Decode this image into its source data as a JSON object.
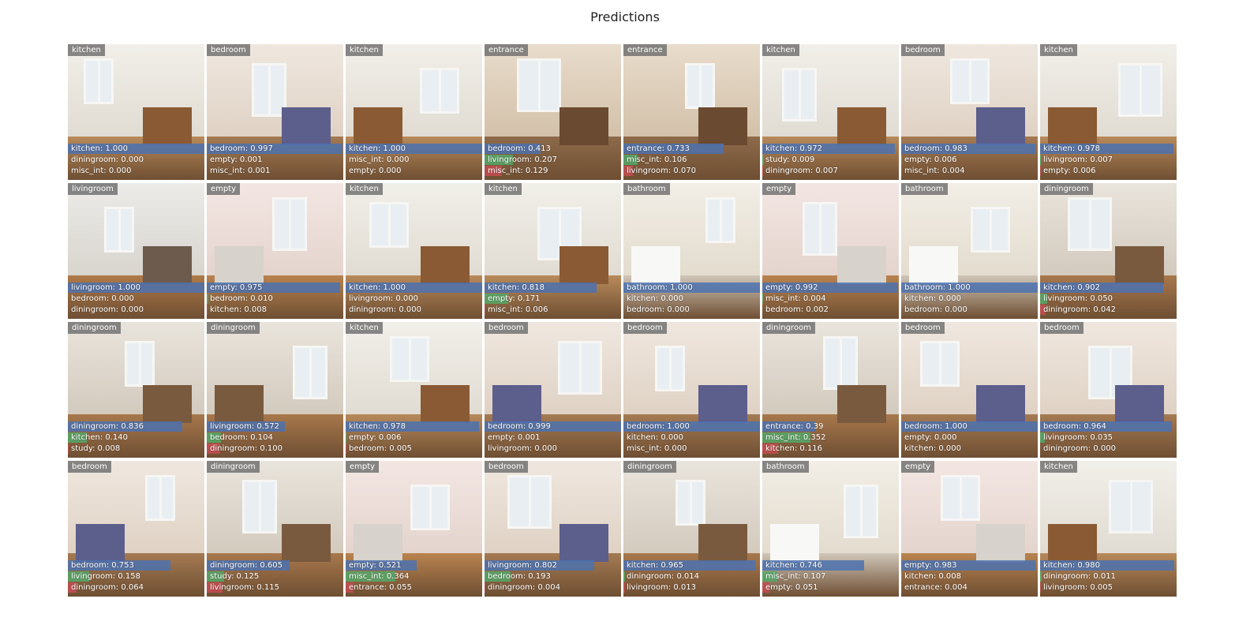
{
  "title": "Predictions",
  "colors": {
    "top_prediction_bar": "#4c72b0",
    "second_prediction_bar": "#55a868",
    "third_prediction_bar": "#c44e52",
    "label_tag": "#6e6e6e"
  },
  "cells": [
    {
      "label": "kitchen",
      "preds": [
        {
          "text": "kitchen: 1.000",
          "score": 1.0
        },
        {
          "text": "diningroom: 0.000",
          "score": 0.0
        },
        {
          "text": "misc_int: 0.000",
          "score": 0.0
        }
      ]
    },
    {
      "label": "bedroom",
      "preds": [
        {
          "text": "bedroom: 0.997",
          "score": 0.997
        },
        {
          "text": "empty: 0.001",
          "score": 0.001
        },
        {
          "text": "misc_int: 0.001",
          "score": 0.001
        }
      ]
    },
    {
      "label": "kitchen",
      "preds": [
        {
          "text": "kitchen: 1.000",
          "score": 1.0
        },
        {
          "text": "misc_int: 0.000",
          "score": 0.0
        },
        {
          "text": "empty: 0.000",
          "score": 0.0
        }
      ]
    },
    {
      "label": "entrance",
      "preds": [
        {
          "text": "bedroom: 0.413",
          "score": 0.413
        },
        {
          "text": "livingroom: 0.207",
          "score": 0.207
        },
        {
          "text": "misc_int: 0.129",
          "score": 0.129
        }
      ]
    },
    {
      "label": "entrance",
      "preds": [
        {
          "text": "entrance: 0.733",
          "score": 0.733
        },
        {
          "text": "misc_int: 0.106",
          "score": 0.106
        },
        {
          "text": "livingroom: 0.070",
          "score": 0.07
        }
      ]
    },
    {
      "label": "kitchen",
      "preds": [
        {
          "text": "kitchen: 0.972",
          "score": 0.972
        },
        {
          "text": "study: 0.009",
          "score": 0.009
        },
        {
          "text": "diningroom: 0.007",
          "score": 0.007
        }
      ]
    },
    {
      "label": "bedroom",
      "preds": [
        {
          "text": "bedroom: 0.983",
          "score": 0.983
        },
        {
          "text": "empty: 0.006",
          "score": 0.006
        },
        {
          "text": "misc_int: 0.004",
          "score": 0.004
        }
      ]
    },
    {
      "label": "kitchen",
      "preds": [
        {
          "text": "kitchen: 0.978",
          "score": 0.978
        },
        {
          "text": "livingroom: 0.007",
          "score": 0.007
        },
        {
          "text": "empty: 0.006",
          "score": 0.006
        }
      ]
    },
    {
      "label": "livingroom",
      "preds": [
        {
          "text": "livingroom: 1.000",
          "score": 1.0
        },
        {
          "text": "bedroom: 0.000",
          "score": 0.0
        },
        {
          "text": "diningroom: 0.000",
          "score": 0.0
        }
      ]
    },
    {
      "label": "empty",
      "preds": [
        {
          "text": "empty: 0.975",
          "score": 0.975
        },
        {
          "text": "bedroom: 0.010",
          "score": 0.01
        },
        {
          "text": "kitchen: 0.008",
          "score": 0.008
        }
      ]
    },
    {
      "label": "kitchen",
      "preds": [
        {
          "text": "kitchen: 1.000",
          "score": 1.0
        },
        {
          "text": "livingroom: 0.000",
          "score": 0.0
        },
        {
          "text": "diningroom: 0.000",
          "score": 0.0
        }
      ]
    },
    {
      "label": "kitchen",
      "preds": [
        {
          "text": "kitchen: 0.818",
          "score": 0.818
        },
        {
          "text": "empty: 0.171",
          "score": 0.171
        },
        {
          "text": "misc_int: 0.006",
          "score": 0.006
        }
      ]
    },
    {
      "label": "bathroom",
      "preds": [
        {
          "text": "bathroom: 1.000",
          "score": 1.0
        },
        {
          "text": "kitchen: 0.000",
          "score": 0.0
        },
        {
          "text": "bedroom: 0.000",
          "score": 0.0
        }
      ]
    },
    {
      "label": "empty",
      "preds": [
        {
          "text": "empty: 0.992",
          "score": 0.992
        },
        {
          "text": "misc_int: 0.004",
          "score": 0.004
        },
        {
          "text": "bedroom: 0.002",
          "score": 0.002
        }
      ]
    },
    {
      "label": "bathroom",
      "preds": [
        {
          "text": "bathroom: 1.000",
          "score": 1.0
        },
        {
          "text": "kitchen: 0.000",
          "score": 0.0
        },
        {
          "text": "bedroom: 0.000",
          "score": 0.0
        }
      ]
    },
    {
      "label": "diningroom",
      "preds": [
        {
          "text": "kitchen: 0.902",
          "score": 0.902
        },
        {
          "text": "livingroom: 0.050",
          "score": 0.05
        },
        {
          "text": "diningroom: 0.042",
          "score": 0.042
        }
      ]
    },
    {
      "label": "diningroom",
      "preds": [
        {
          "text": "diningroom: 0.836",
          "score": 0.836
        },
        {
          "text": "kitchen: 0.140",
          "score": 0.14
        },
        {
          "text": "study: 0.008",
          "score": 0.008
        }
      ]
    },
    {
      "label": "diningroom",
      "preds": [
        {
          "text": "livingroom: 0.572",
          "score": 0.572
        },
        {
          "text": "bedroom: 0.104",
          "score": 0.104
        },
        {
          "text": "diningroom: 0.100",
          "score": 0.1
        }
      ]
    },
    {
      "label": "kitchen",
      "preds": [
        {
          "text": "kitchen: 0.978",
          "score": 0.978
        },
        {
          "text": "empty: 0.006",
          "score": 0.006
        },
        {
          "text": "bedroom: 0.005",
          "score": 0.005
        }
      ]
    },
    {
      "label": "bedroom",
      "preds": [
        {
          "text": "bedroom: 0.999",
          "score": 0.999
        },
        {
          "text": "empty: 0.001",
          "score": 0.001
        },
        {
          "text": "livingroom: 0.000",
          "score": 0.0
        }
      ]
    },
    {
      "label": "bedroom",
      "preds": [
        {
          "text": "bedroom: 1.000",
          "score": 1.0
        },
        {
          "text": "kitchen: 0.000",
          "score": 0.0
        },
        {
          "text": "misc_int: 0.000",
          "score": 0.0
        }
      ]
    },
    {
      "label": "diningroom",
      "preds": [
        {
          "text": "entrance: 0.39",
          "score": 0.39
        },
        {
          "text": "misc_int: 0.352",
          "score": 0.352
        },
        {
          "text": "kitchen: 0.116",
          "score": 0.116
        }
      ]
    },
    {
      "label": "bedroom",
      "preds": [
        {
          "text": "bedroom: 1.000",
          "score": 1.0
        },
        {
          "text": "empty: 0.000",
          "score": 0.0
        },
        {
          "text": "kitchen: 0.000",
          "score": 0.0
        }
      ]
    },
    {
      "label": "bedroom",
      "preds": [
        {
          "text": "bedroom: 0.964",
          "score": 0.964
        },
        {
          "text": "livingroom: 0.035",
          "score": 0.035
        },
        {
          "text": "diningroom: 0.000",
          "score": 0.0
        }
      ]
    },
    {
      "label": "bedroom",
      "preds": [
        {
          "text": "bedroom: 0.753",
          "score": 0.753
        },
        {
          "text": "livingroom: 0.158",
          "score": 0.158
        },
        {
          "text": "diningroom: 0.064",
          "score": 0.064
        }
      ]
    },
    {
      "label": "diningroom",
      "preds": [
        {
          "text": "diningroom: 0.605",
          "score": 0.605
        },
        {
          "text": "study: 0.125",
          "score": 0.125
        },
        {
          "text": "livingroom: 0.115",
          "score": 0.115
        }
      ]
    },
    {
      "label": "empty",
      "preds": [
        {
          "text": "empty: 0.521",
          "score": 0.521
        },
        {
          "text": "misc_int: 0.364",
          "score": 0.364
        },
        {
          "text": "entrance: 0.055",
          "score": 0.055
        }
      ]
    },
    {
      "label": "bedroom",
      "preds": [
        {
          "text": "livingroom: 0.802",
          "score": 0.802
        },
        {
          "text": "bedroom: 0.193",
          "score": 0.193
        },
        {
          "text": "diningroom: 0.004",
          "score": 0.004
        }
      ]
    },
    {
      "label": "diningroom",
      "preds": [
        {
          "text": "kitchen: 0.965",
          "score": 0.965
        },
        {
          "text": "diningroom: 0.014",
          "score": 0.014
        },
        {
          "text": "livingroom: 0.013",
          "score": 0.013
        }
      ]
    },
    {
      "label": "bathroom",
      "preds": [
        {
          "text": "kitchen: 0.746",
          "score": 0.746
        },
        {
          "text": "misc_int: 0.107",
          "score": 0.107
        },
        {
          "text": "empty: 0.051",
          "score": 0.051
        }
      ]
    },
    {
      "label": "empty",
      "preds": [
        {
          "text": "empty: 0.983",
          "score": 0.983
        },
        {
          "text": "kitchen: 0.008",
          "score": 0.008
        },
        {
          "text": "entrance: 0.004",
          "score": 0.004
        }
      ]
    },
    {
      "label": "kitchen",
      "preds": [
        {
          "text": "kitchen: 0.980",
          "score": 0.98
        },
        {
          "text": "diningroom: 0.011",
          "score": 0.011
        },
        {
          "text": "livingroom: 0.005",
          "score": 0.005
        }
      ]
    }
  ]
}
